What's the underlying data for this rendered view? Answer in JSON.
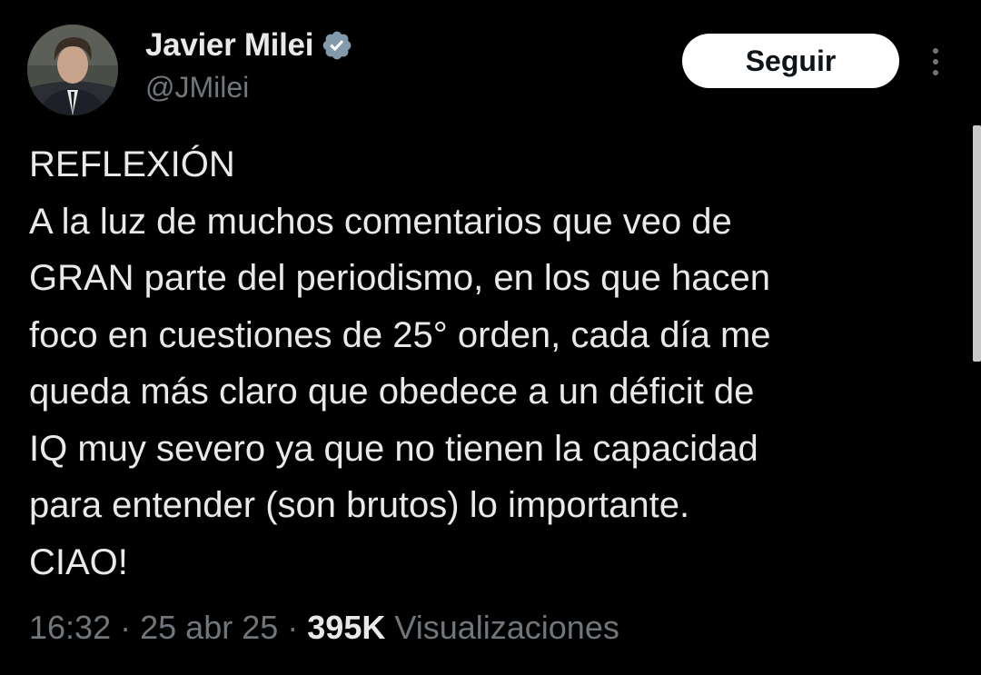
{
  "author": {
    "display_name": "Javier Milei",
    "handle": "@JMilei",
    "verified_icon": "verified-badge-icon",
    "avatar_icon": "avatar"
  },
  "actions": {
    "follow_label": "Seguir",
    "more_icon": "more-options-icon"
  },
  "tweet": {
    "lines": [
      "REFLEXIÓN",
      "A la luz de muchos comentarios que veo de",
      "GRAN parte del periodismo, en los que hacen",
      "foco en cuestiones de 25° orden, cada día me",
      "queda más claro que obedece a un déficit de",
      "IQ muy severo ya que no tienen la capacidad",
      "para entender (son brutos) lo importante.",
      "CIAO!"
    ]
  },
  "meta": {
    "time": "16:32",
    "separator": "·",
    "date": "25 abr 25",
    "views_count": "395K",
    "views_label": "Visualizaciones"
  },
  "colors": {
    "background": "#000000",
    "primary_text": "#e7e9ea",
    "secondary_text": "#71767b",
    "verified_badge": "#829aab",
    "follow_button_bg": "#ffffff"
  }
}
